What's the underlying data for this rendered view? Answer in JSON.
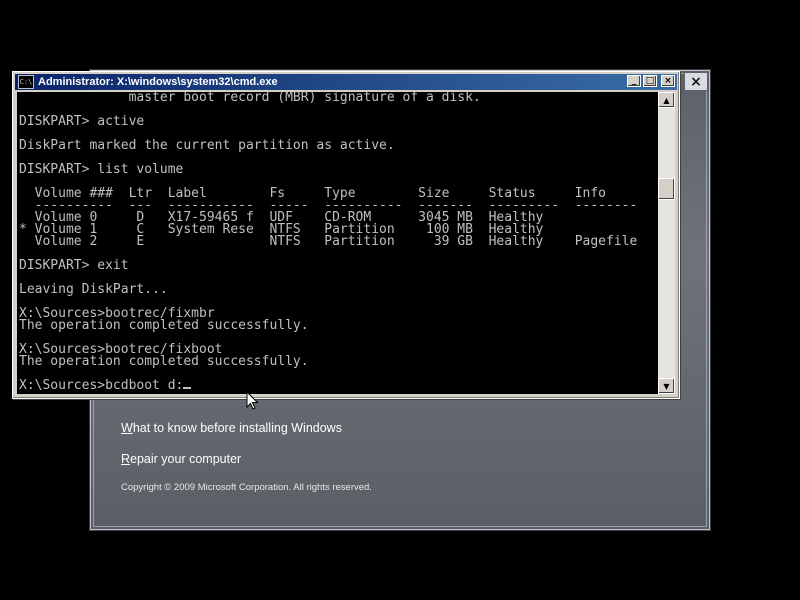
{
  "background_window": {
    "close_label": "×",
    "links": [
      {
        "access_key": "W",
        "rest": "hat to know before installing Windows"
      },
      {
        "access_key": "R",
        "rest": "epair your computer"
      }
    ],
    "copyright": "Copyright © 2009 Microsoft Corporation. All rights reserved."
  },
  "cmd": {
    "title": "Administrator: X:\\windows\\system32\\cmd.exe",
    "icon_text": "C:\\",
    "buttons": {
      "minimize": "_",
      "maximize": "□",
      "close": "×"
    },
    "lines": [
      "              master boot record (MBR) signature of a disk.",
      "",
      "DISKPART> active",
      "",
      "DiskPart marked the current partition as active.",
      "",
      "DISKPART> list volume",
      "",
      "  Volume ###  Ltr  Label        Fs     Type        Size     Status     Info",
      "  ----------  ---  -----------  -----  ----------  -------  ---------  --------",
      "  Volume 0     D   X17-59465 f  UDF    CD-ROM      3045 MB  Healthy",
      "* Volume 1     C   System Rese  NTFS   Partition    100 MB  Healthy",
      "  Volume 2     E                NTFS   Partition     39 GB  Healthy    Pagefile",
      "",
      "DISKPART> exit",
      "",
      "Leaving DiskPart...",
      "",
      "X:\\Sources>bootrec/fixmbr",
      "The operation completed successfully.",
      "",
      "X:\\Sources>bootrec/fixboot",
      "The operation completed successfully.",
      ""
    ],
    "prompt_line": "X:\\Sources>bcdboot d:",
    "scrollbar": {
      "up": "▲",
      "down": "▼"
    }
  }
}
